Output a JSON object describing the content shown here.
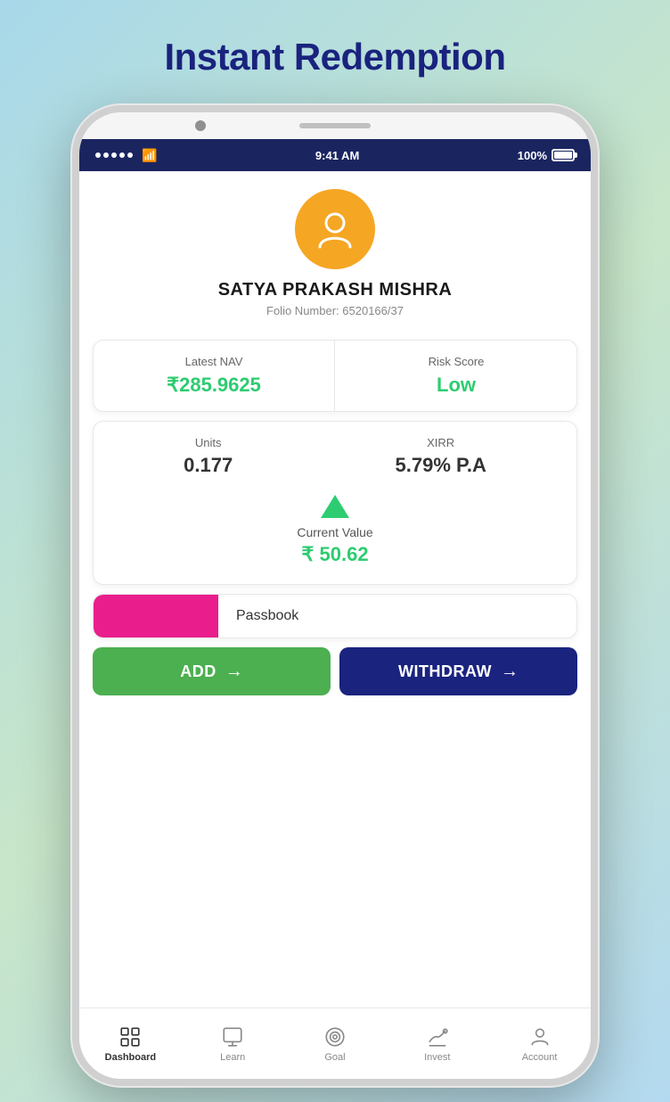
{
  "page": {
    "title": "Instant Redemption",
    "background_gradient": "linear-gradient(135deg, #a8d8ea 0%, #c8e6c9 50%, #b3d9f0 100%)"
  },
  "status_bar": {
    "time": "9:41 AM",
    "battery": "100%",
    "signal_dots": 5
  },
  "profile": {
    "name": "SATYA PRAKASH MISHRA",
    "folio_label": "Folio Number:",
    "folio_number": "6520166/37"
  },
  "stats_card1": {
    "nav_label": "Latest NAV",
    "nav_value": "₹285.9625",
    "risk_label": "Risk Score",
    "risk_value": "Low"
  },
  "stats_card2": {
    "units_label": "Units",
    "units_value": "0.177",
    "xirr_label": "XIRR",
    "xirr_value": "5.79% P.A",
    "current_value_label": "Current Value",
    "current_value": "₹ 50.62"
  },
  "passbook": {
    "label": "Passbook"
  },
  "buttons": {
    "add_label": "ADD",
    "withdraw_label": "WITHDRAW"
  },
  "bottom_nav": {
    "items": [
      {
        "id": "dashboard",
        "label": "Dashboard",
        "active": true
      },
      {
        "id": "learn",
        "label": "Learn",
        "active": false
      },
      {
        "id": "goal",
        "label": "Goal",
        "active": false
      },
      {
        "id": "invest",
        "label": "Invest",
        "active": false
      },
      {
        "id": "account",
        "label": "Account",
        "active": false
      }
    ]
  }
}
